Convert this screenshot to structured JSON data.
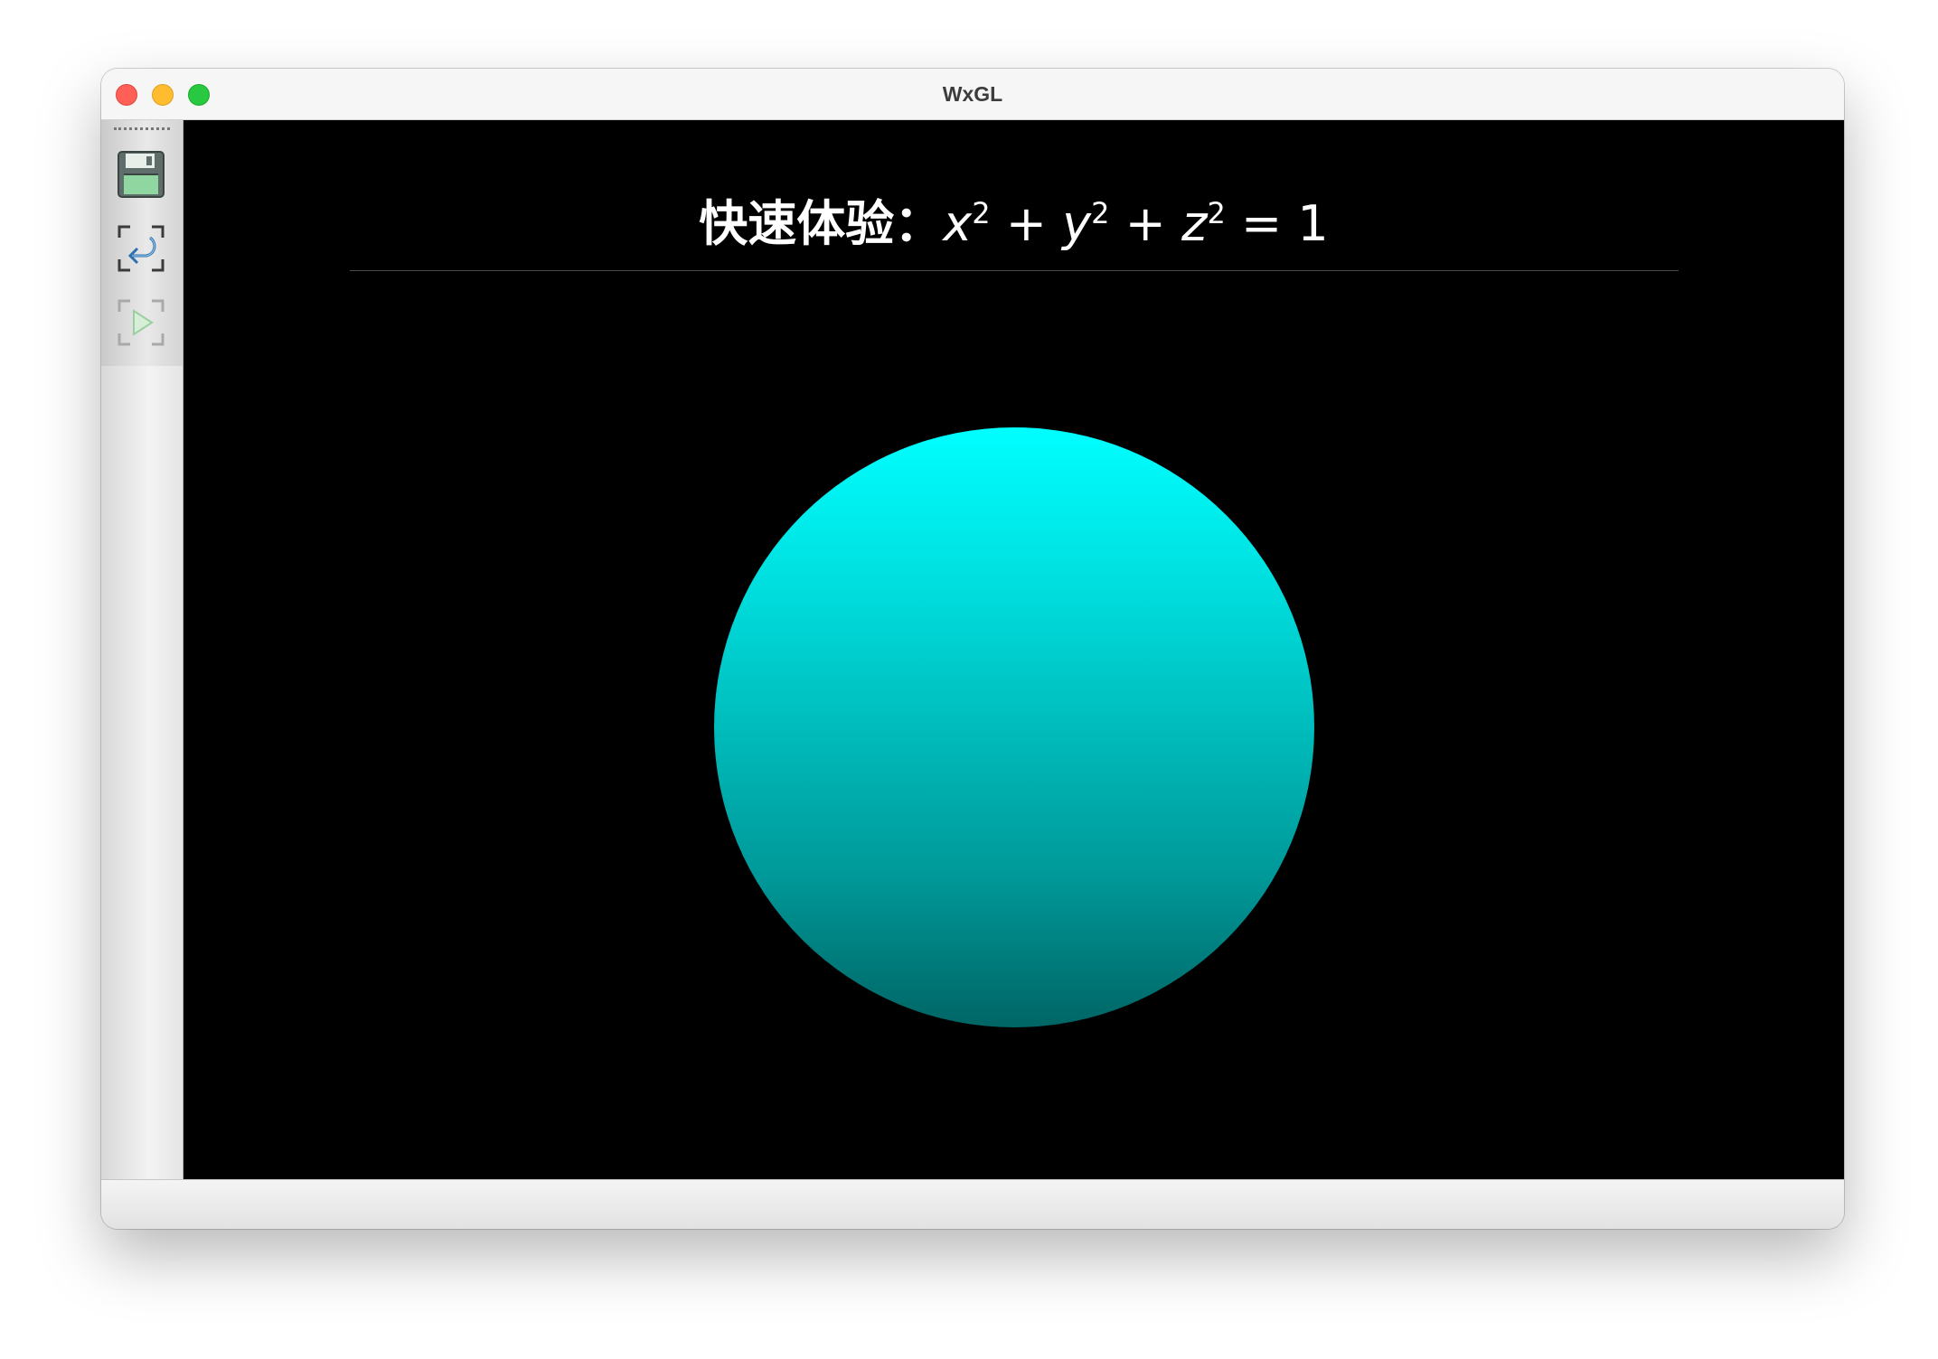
{
  "window": {
    "title": "WxGL"
  },
  "toolbar": {
    "items": [
      {
        "icon": "save-icon",
        "label": "save"
      },
      {
        "icon": "restore-icon",
        "label": "restore"
      },
      {
        "icon": "play-icon",
        "label": "play",
        "disabled": true
      }
    ]
  },
  "canvas": {
    "background": "#000000",
    "title_cn": "快速体验：",
    "sphere_top_color": "#00ffff",
    "sphere_bottom_color": "#006565"
  }
}
